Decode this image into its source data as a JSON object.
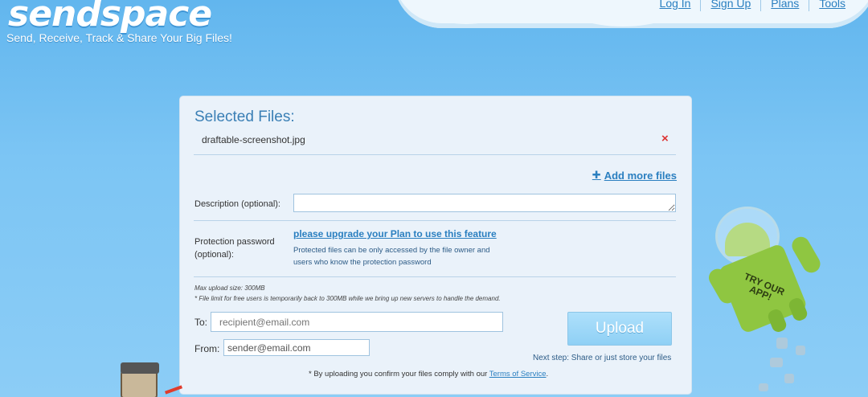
{
  "header": {
    "logo": "sendspace",
    "tagline": "Send, Receive, Track & Share Your Big Files!",
    "nav": [
      "Log In",
      "Sign Up",
      "Plans",
      "Tools"
    ]
  },
  "panel": {
    "title": "Selected Files:",
    "files": [
      "draftable-screenshot.jpg"
    ],
    "remove_icon": "×",
    "add_more": "Add more files",
    "description_label": "Description (optional):",
    "password_label_1": "Protection password",
    "password_label_2": "(optional):",
    "upgrade_link": "please upgrade your Plan to use this feature",
    "protect_note_1": "Protected files can be only accessed by the file owner and",
    "protect_note_2": "users who know the protection password",
    "max_upload": "Max upload size: 300MB",
    "file_limit_note": "* File limit for free users is temporarily back to 300MB while we bring up new servers to handle the demand.",
    "to_label": "To:",
    "to_placeholder": "recipient@email.com",
    "from_label": "From:",
    "from_value": "sender@email.com",
    "upload_button": "Upload",
    "next_step": "Next step: Share or just store your files",
    "tos_prefix": "* By uploading you confirm your files comply with our ",
    "tos_link": "Terms of Service",
    "tos_suffix": "."
  },
  "mascot": {
    "line1": "TRY OUR",
    "line2": "APP!"
  },
  "colors": {
    "link": "#2a7fc0",
    "panel_bg": "#eaf2fa",
    "remove_icon": "#dd3333",
    "android_green": "#8fc641"
  }
}
